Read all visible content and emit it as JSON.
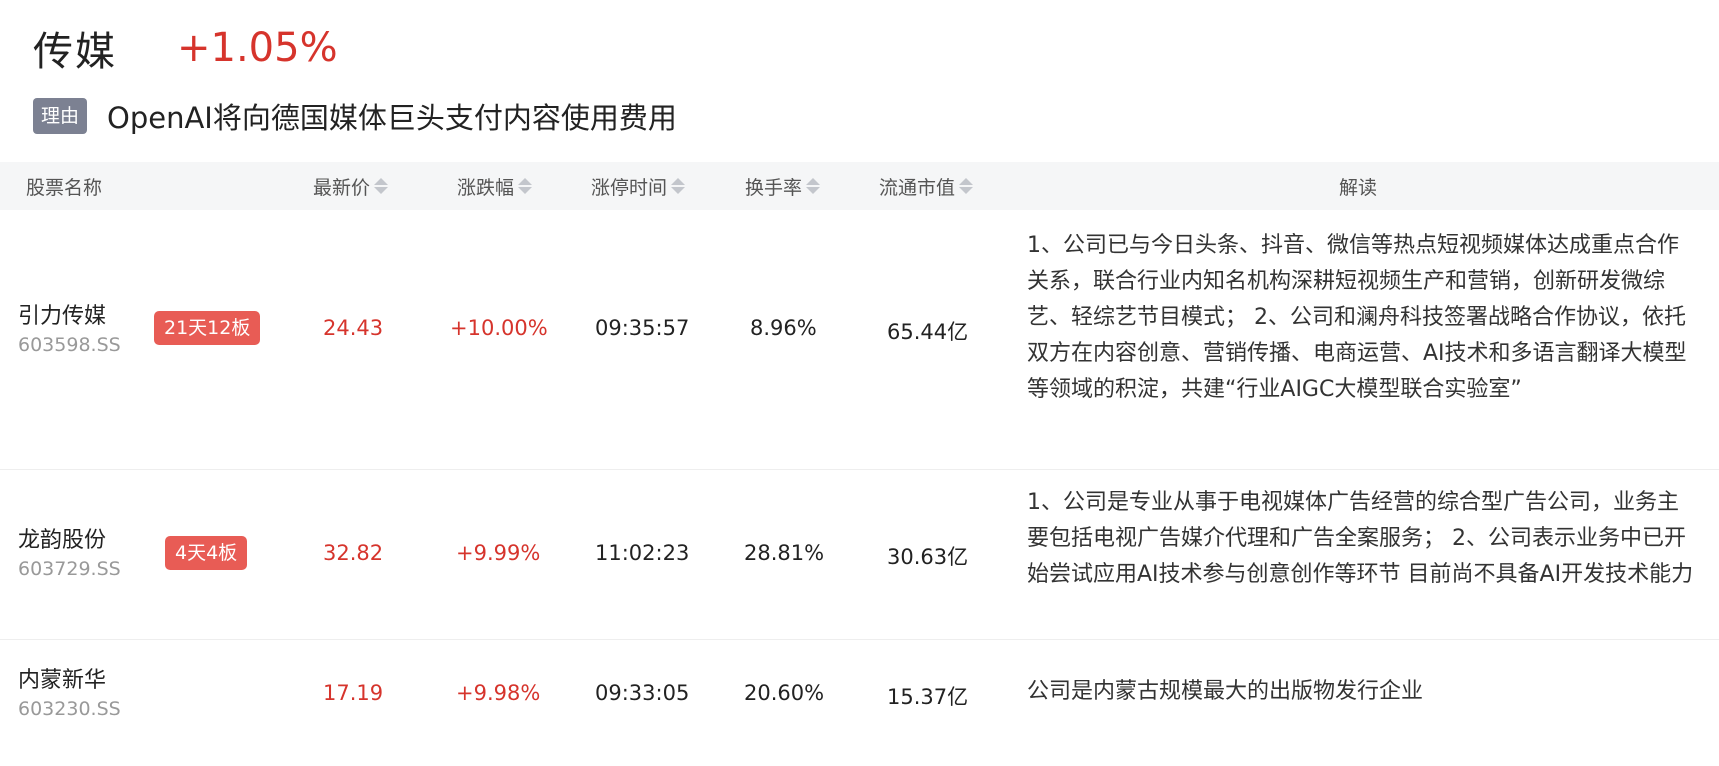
{
  "header": {
    "sector_name": "传媒",
    "sector_change": "+1.05%",
    "reason_tag": "理由",
    "reason_text": "OpenAI将向德国媒体巨头支付内容使用费用"
  },
  "colors": {
    "up_red": "#d6342c",
    "badge_red": "#e85c55",
    "tag_gray": "#7c8192"
  },
  "table": {
    "columns": {
      "name": "股票名称",
      "price": "最新价",
      "change": "涨跌幅",
      "limit_time": "涨停时间",
      "turnover": "换手率",
      "market_cap": "流通市值",
      "analysis": "解读"
    },
    "rows": [
      {
        "name": "引力传媒",
        "code": "603598.SS",
        "badge": "21天12板",
        "price": "24.43",
        "change": "+10.00%",
        "limit_time": "09:35:57",
        "turnover": "8.96%",
        "market_cap": "65.44亿",
        "analysis": "1、公司已与今日头条、抖音、微信等热点短视频媒体达成重点合作关系，联合行业内知名机构深耕短视频生产和营销，创新研发微综艺、轻综艺节目模式； 2、公司和澜舟科技签署战略合作协议，依托双方在内容创意、营销传播、电商运营、AI技术和多语言翻译大模型等领域的积淀，共建“行业AIGC大模型联合实验室”"
      },
      {
        "name": "龙韵股份",
        "code": "603729.SS",
        "badge": "4天4板",
        "price": "32.82",
        "change": "+9.99%",
        "limit_time": "11:02:23",
        "turnover": "28.81%",
        "market_cap": "30.63亿",
        "analysis": "1、公司是专业从事于电视媒体广告经营的综合型广告公司，业务主要包括电视广告媒介代理和广告全案服务； 2、公司表示业务中已开始尝试应用AI技术参与创意创作等环节 目前尚不具备AI开发技术能力"
      },
      {
        "name": "内蒙新华",
        "code": "603230.SS",
        "badge": "",
        "price": "17.19",
        "change": "+9.98%",
        "limit_time": "09:33:05",
        "turnover": "20.60%",
        "market_cap": "15.37亿",
        "analysis": "公司是内蒙古规模最大的出版物发行企业"
      }
    ]
  }
}
